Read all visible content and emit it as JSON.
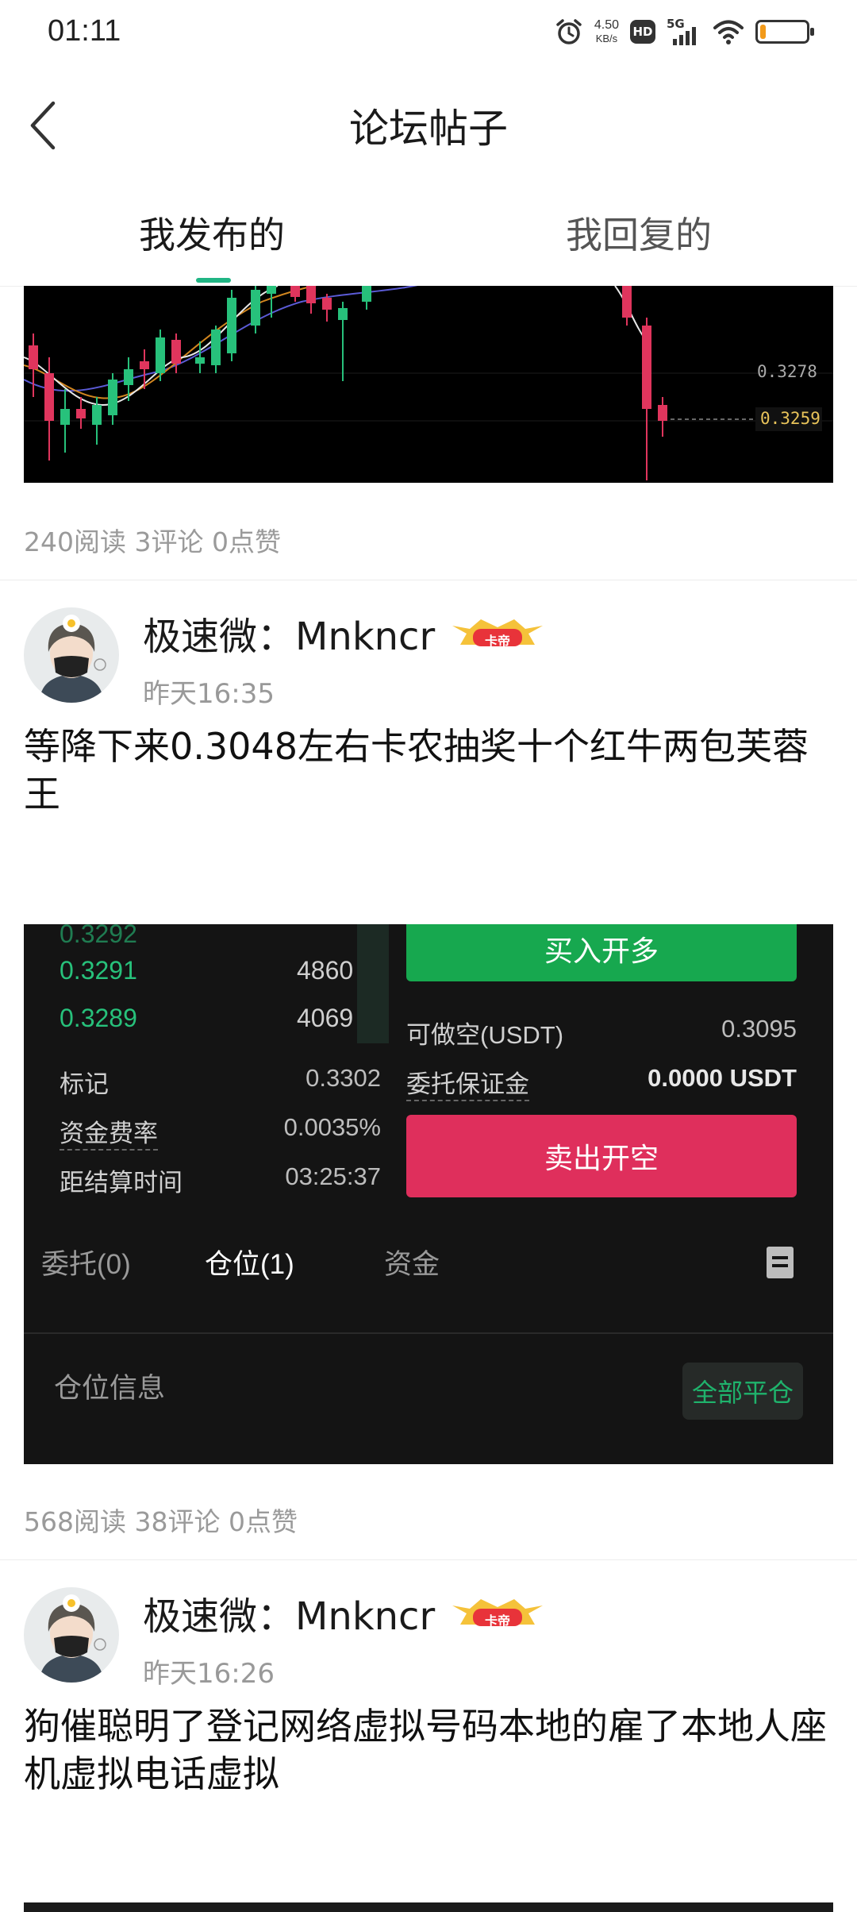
{
  "status_bar": {
    "time": "01:11",
    "net_speed_value": "4.50",
    "net_speed_unit": "KB/s",
    "hd_label": "HD",
    "signal_label": "5G",
    "battery_level": 0.12
  },
  "header": {
    "title": "论坛帖子"
  },
  "tabs": {
    "mine": "我发布的",
    "replied": "我回复的"
  },
  "posts": [
    {
      "chart_price_1": "0.3278",
      "chart_price_2": "0.3259",
      "stats": "240阅读 3评论 0点赞"
    },
    {
      "author": "极速微：Mnkncr",
      "badge": "卡帝",
      "time": "昨天16:35",
      "text": "等降下来0.3048左右卡农抽奖十个红牛两包芙蓉王",
      "trade": {
        "orderbook": [
          {
            "price": "0.3291",
            "qty": "4860"
          },
          {
            "price": "0.3289",
            "qty": "4069"
          }
        ],
        "mark_label": "标记",
        "mark_value": "0.3302",
        "funding_label": "资金费率",
        "funding_value": "0.0035%",
        "settle_label": "距结算时间",
        "settle_value": "03:25:37",
        "buy_label": "买入开多",
        "short_label": "可做空(USDT)",
        "short_value": "0.3095",
        "margin_label": "委托保证金",
        "margin_value": "0.0000 USDT",
        "sell_label": "卖出开空",
        "tab_orders": "委托(0)",
        "tab_positions": "仓位(1)",
        "tab_funds": "资金",
        "position_info": "仓位信息",
        "close_all": "全部平仓"
      },
      "stats": "568阅读 38评论 0点赞"
    },
    {
      "author": "极速微：Mnkncr",
      "badge": "卡帝",
      "time": "昨天16:26",
      "text": "狗催聪明了登记网络虚拟号码本地的雇了本地人座机虚拟电话虚拟"
    }
  ],
  "colors": {
    "accent": "#20b584",
    "buy": "#17a84f",
    "sell": "#df2f5c",
    "badge": "#e8333a"
  }
}
